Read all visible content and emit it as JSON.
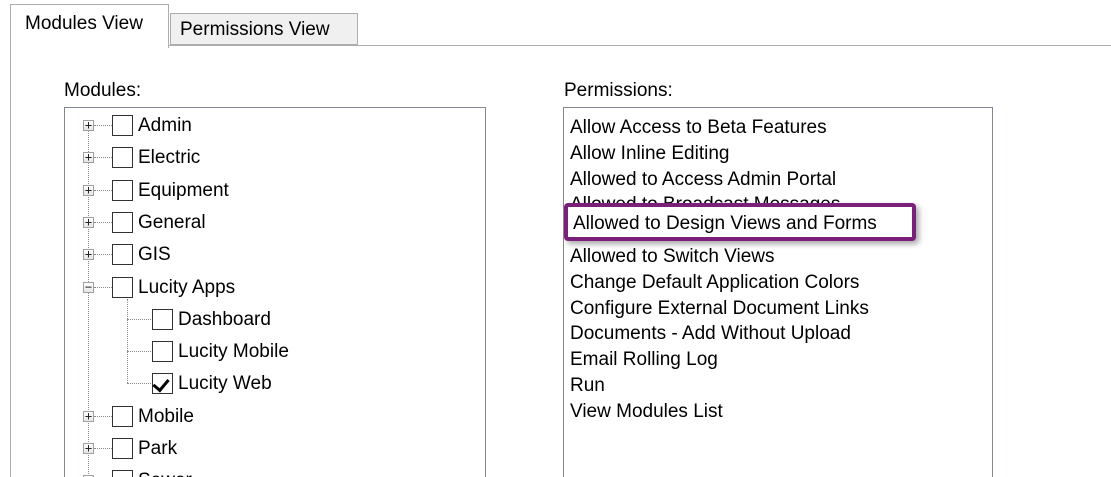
{
  "tabs": [
    {
      "label": "Modules View",
      "active": true
    },
    {
      "label": "Permissions View",
      "active": false
    }
  ],
  "modules": {
    "label": "Modules:",
    "items": [
      {
        "label": "Admin",
        "expander": "+",
        "checked": false,
        "level": 0
      },
      {
        "label": "Electric",
        "expander": "+",
        "checked": false,
        "level": 0
      },
      {
        "label": "Equipment",
        "expander": "+",
        "checked": false,
        "level": 0
      },
      {
        "label": "General",
        "expander": "+",
        "checked": false,
        "level": 0
      },
      {
        "label": "GIS",
        "expander": "+",
        "checked": false,
        "level": 0
      },
      {
        "label": "Lucity Apps",
        "expander": "−",
        "checked": false,
        "level": 0
      },
      {
        "label": "Dashboard",
        "expander": "",
        "checked": false,
        "level": 1
      },
      {
        "label": "Lucity Mobile",
        "expander": "",
        "checked": false,
        "level": 1
      },
      {
        "label": "Lucity Web",
        "expander": "",
        "checked": true,
        "level": 1
      },
      {
        "label": "Mobile",
        "expander": "+",
        "checked": false,
        "level": 0
      },
      {
        "label": "Park",
        "expander": "+",
        "checked": false,
        "level": 0
      },
      {
        "label": "Sewer",
        "expander": "+",
        "checked": false,
        "level": 0
      }
    ]
  },
  "permissions": {
    "label": "Permissions:",
    "items": [
      "Allow Access to Beta Features",
      "Allow Inline Editing",
      "Allowed to Access Admin Portal",
      "Allowed to Broadcast Messages",
      "Allowed to Design Views and Forms",
      "Allowed to Switch Views",
      "Change Default Application Colors",
      "Configure External Document Links",
      "Documents - Add Without Upload",
      "Email Rolling Log",
      "Run",
      "View Modules List"
    ],
    "highlighted": "Allowed to Design Views and Forms",
    "highlight_color": "#7a1f7a"
  }
}
